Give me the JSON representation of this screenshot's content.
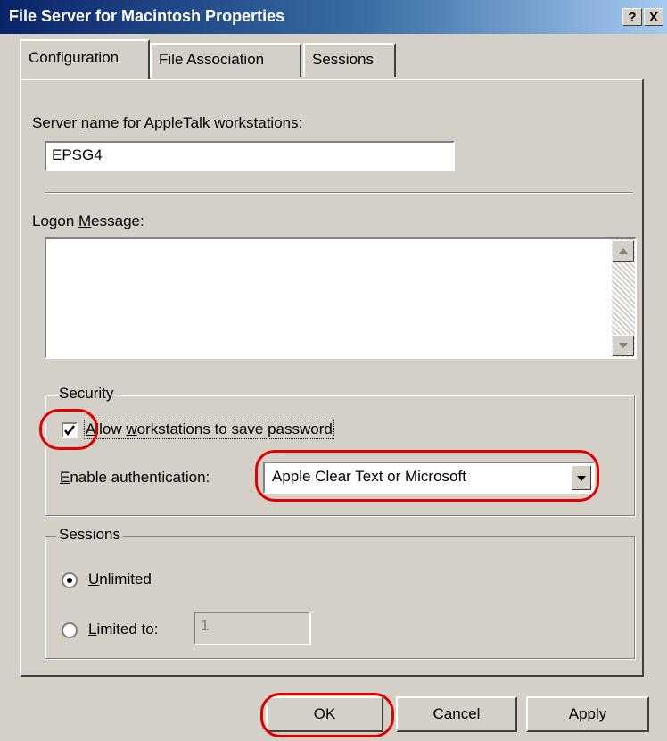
{
  "window": {
    "title": "File Server for Macintosh Properties",
    "help_button": "?",
    "close_button": "X"
  },
  "tabs": [
    {
      "label": "Configuration",
      "active": true
    },
    {
      "label": "File Association",
      "active": false
    },
    {
      "label": "Sessions",
      "active": false
    }
  ],
  "server_name": {
    "label_pre": "Server ",
    "label_key": "n",
    "label_post": "ame for AppleTalk workstations:",
    "value": "EPSG4"
  },
  "logon_message": {
    "label_pre": "Logon ",
    "label_key": "M",
    "label_post": "essage:",
    "value": ""
  },
  "security": {
    "title": "Security",
    "allow_save_password": {
      "label_key": "A",
      "label_post": "llow ",
      "label_key2": "w",
      "label_post2": "orkstations to save password",
      "checked": true
    },
    "enable_auth": {
      "label_key": "E",
      "label_post": "nable authentication:",
      "selected": "Apple Clear Text or Microsoft"
    }
  },
  "sessions": {
    "title": "Sessions",
    "unlimited": {
      "label_key": "U",
      "label_post": "nlimited",
      "selected": true
    },
    "limited": {
      "label_key": "L",
      "label_post": "imited to:",
      "selected": false,
      "value": "1"
    }
  },
  "buttons": {
    "ok": "OK",
    "cancel": "Cancel",
    "apply_key": "A",
    "apply_post": "pply"
  },
  "colors": {
    "dialog_face": "#d4d0c8",
    "title_gradient_start": "#0a246a",
    "title_gradient_end": "#a6caf0",
    "highlight_ring": "#e00000"
  }
}
